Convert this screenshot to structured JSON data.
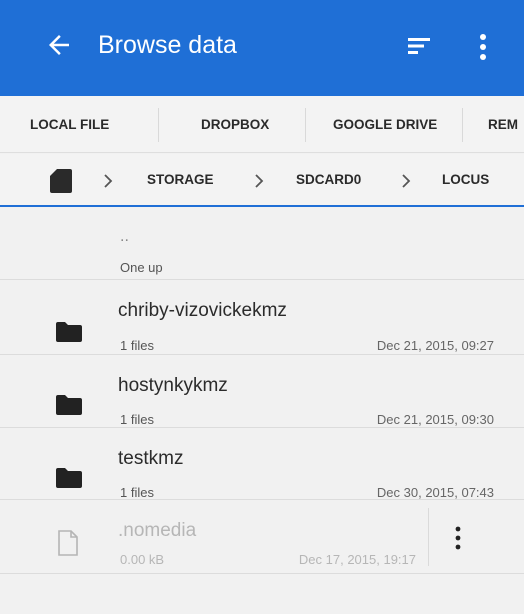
{
  "appbar": {
    "title": "Browse data",
    "back_icon": "arrow-left-icon",
    "sort_icon": "sort-icon",
    "more_icon": "more-vert-icon",
    "color": "#1f6fd6"
  },
  "tabs": [
    {
      "label": "LOCAL FILE"
    },
    {
      "label": "DROPBOX"
    },
    {
      "label": "GOOGLE DRIVE"
    },
    {
      "label": "REM"
    }
  ],
  "breadcrumb": {
    "root_icon": "sd-card-icon",
    "items": [
      {
        "label": "STORAGE"
      },
      {
        "label": "SDCARD0"
      },
      {
        "label": "LOCUS"
      }
    ]
  },
  "list": {
    "up": {
      "name": "..",
      "label": "One up"
    },
    "items": [
      {
        "name": "chriby-vizovickekmz",
        "meta": "1 files",
        "date": "Dec 21, 2015, 09:27",
        "icon": "folder-icon"
      },
      {
        "name": "hostynkykmz",
        "meta": "1 files",
        "date": "Dec 21, 2015, 09:30",
        "icon": "folder-icon"
      },
      {
        "name": "testkmz",
        "meta": "1 files",
        "date": "Dec 30, 2015, 07:43",
        "icon": "folder-icon"
      },
      {
        "name": ".nomedia",
        "meta": "0.00 kB",
        "date": "Dec 17, 2015, 19:17",
        "icon": "file-icon"
      }
    ]
  }
}
